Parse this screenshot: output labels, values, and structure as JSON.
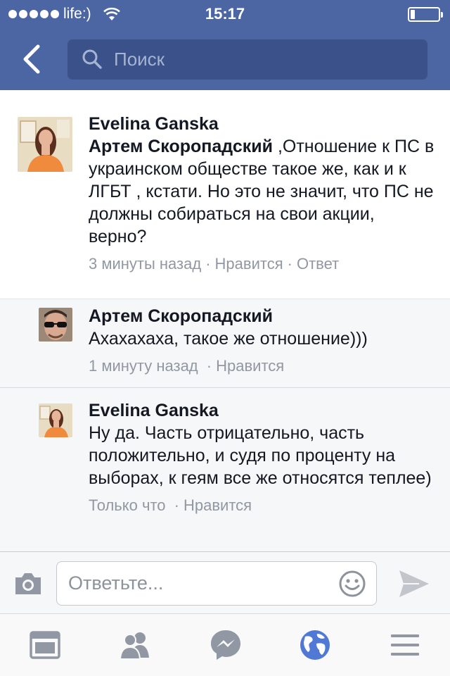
{
  "status_bar": {
    "carrier": "life:)",
    "time": "15:17",
    "battery_level": 0.15
  },
  "header": {
    "search_placeholder": "Поиск",
    "accent_color": "#4c66a4"
  },
  "comments": [
    {
      "author": "Evelina Ganska",
      "mention": "Артем Скоропадский",
      "text": ",Отношение к ПС в украинском обществе такое же, как и к ЛГБТ , кстати. Но это не значит, что ПС не должны собираться на свои акции, верно?",
      "time": "3 минуты назад",
      "like_label": "Нравится",
      "reply_label": "Ответ"
    },
    {
      "author": "Артем Скоропадский",
      "text": "Ахахахаха, такое же отношение)))",
      "time": "1 минуту назад",
      "like_label": "Нравится"
    },
    {
      "author": "Evelina Ganska",
      "text": "Ну да. Часть отрицательно, часть положительно, и судя по проценту на выборах, к геям все же относятся теплее)",
      "time": "Только что",
      "like_label": "Нравится"
    }
  ],
  "composer": {
    "placeholder": "Ответьте..."
  },
  "tab_bar": {
    "tabs": [
      {
        "icon": "news-feed-icon",
        "active": false
      },
      {
        "icon": "friends-icon",
        "active": false
      },
      {
        "icon": "messenger-icon",
        "active": false
      },
      {
        "icon": "globe-icon",
        "active": true
      },
      {
        "icon": "menu-icon",
        "active": false
      }
    ],
    "active_color": "#4f79d4",
    "inactive_color": "#9197a3"
  }
}
